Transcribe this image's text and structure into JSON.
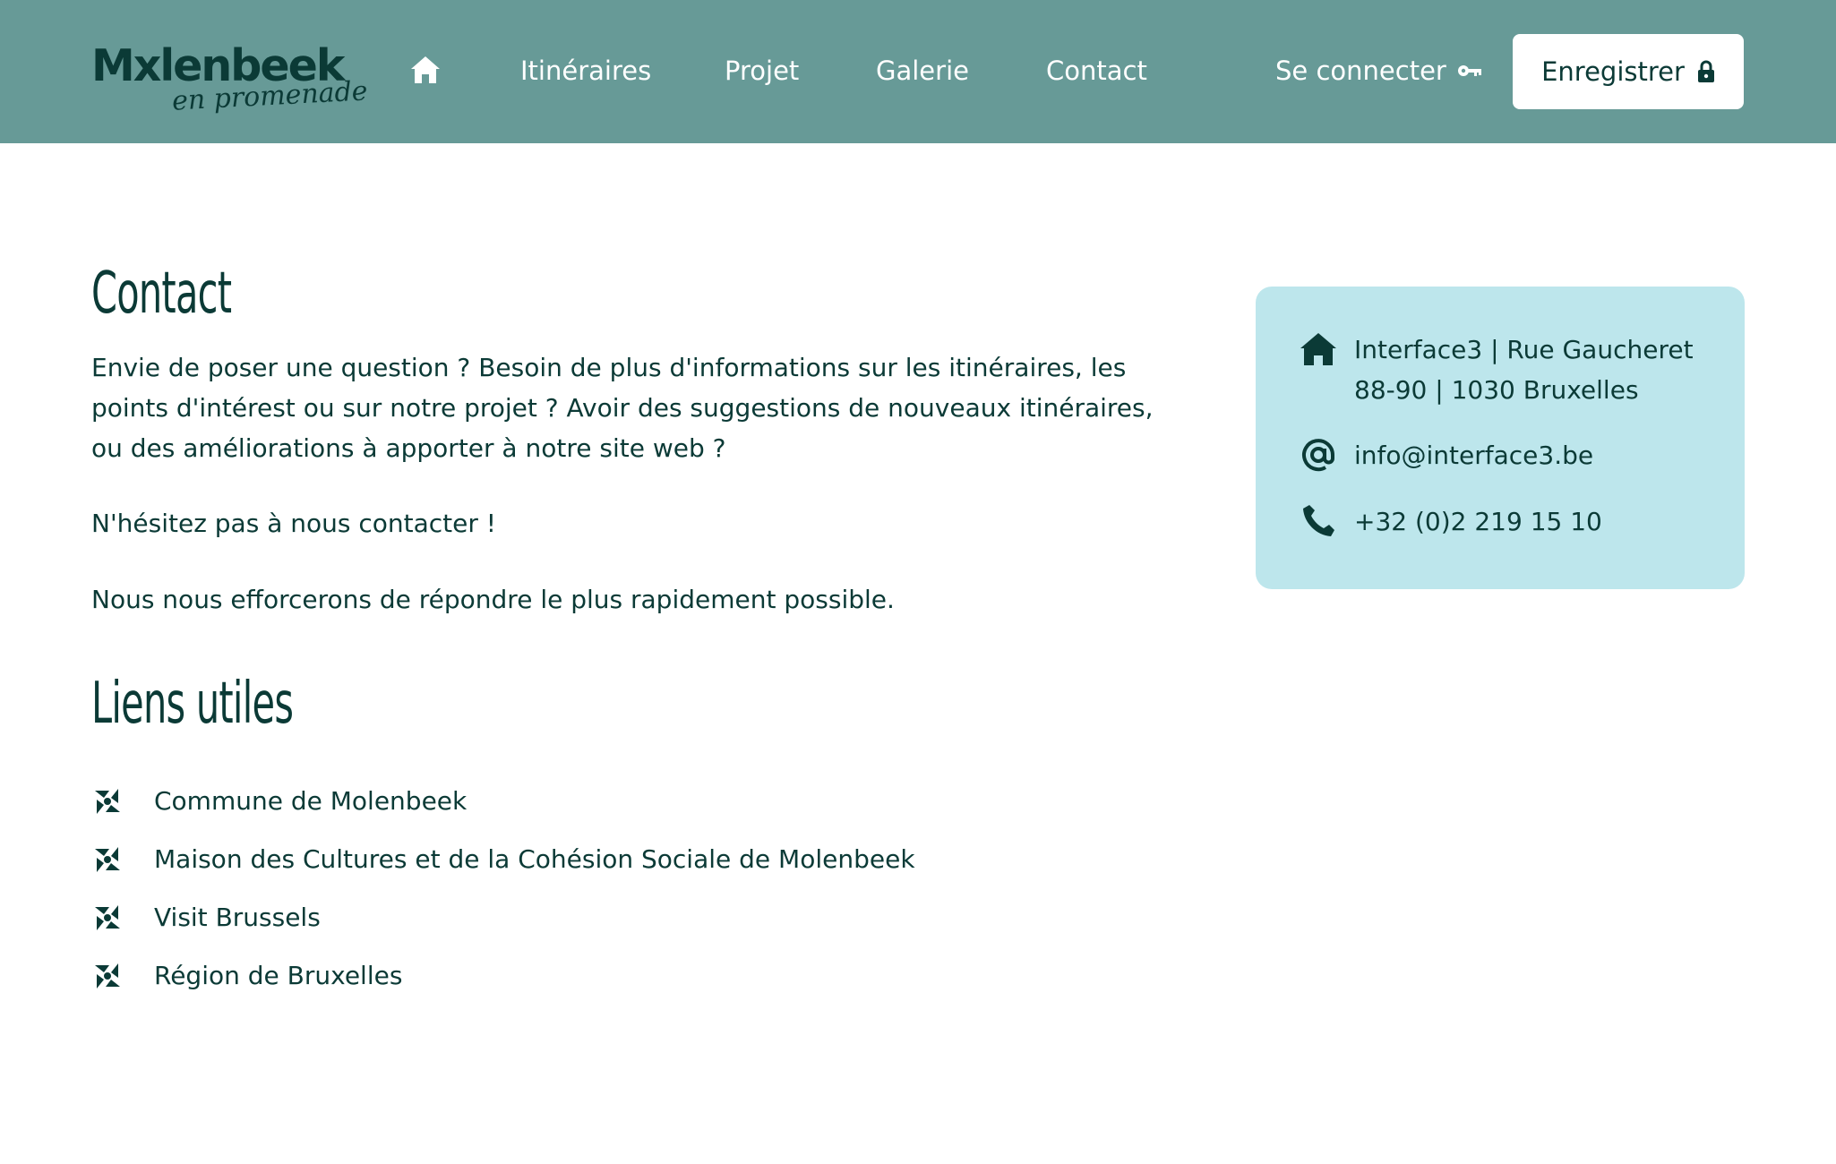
{
  "header": {
    "logo": {
      "main": "Mxlenbeek",
      "sub": "en promenade"
    },
    "nav": {
      "home_icon": "home-icon",
      "itineraires": "Itinéraires",
      "projet": "Projet",
      "galerie": "Galerie",
      "contact": "Contact"
    },
    "login_label": "Se connecter",
    "login_icon": "key-icon",
    "register_label": "Enregistrer",
    "register_icon": "lock-icon"
  },
  "main": {
    "title": "Contact",
    "paragraphs": [
      "Envie de poser une question ? Besoin de plus d'informations sur les itinéraires, les points d'intérest ou sur notre projet ? Avoir des suggestions de nouveaux itinéraires, ou des améliorations à apporter à notre site web ?",
      "N'hésitez pas à nous contacter !",
      "Nous nous efforcerons de répondre le plus rapidement possible."
    ],
    "links_title": "Liens utiles",
    "links": [
      {
        "label": "Commune de Molenbeek",
        "icon": "pinwheel-icon"
      },
      {
        "label": "Maison des Cultures et de la Cohésion Sociale de Molenbeek",
        "icon": "pinwheel-icon"
      },
      {
        "label": "Visit Brussels",
        "icon": "pinwheel-icon"
      },
      {
        "label": "Région de Bruxelles",
        "icon": "pinwheel-icon"
      }
    ]
  },
  "card": {
    "address": "Interface3 | Rue Gaucheret 88-90 | 1030 Bruxelles",
    "email": "info@interface3.be",
    "phone": "+32 (0)2 219 15 10",
    "icons": [
      "home-icon",
      "at-icon",
      "phone-icon"
    ]
  },
  "colors": {
    "header_bg": "#679a97",
    "text_dark": "#0b3a36",
    "card_bg": "#bde6ec",
    "white": "#ffffff"
  }
}
